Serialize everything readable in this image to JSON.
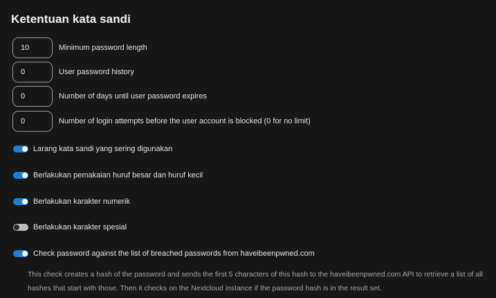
{
  "section": {
    "title": "Ketentuan kata sandi"
  },
  "number_settings": [
    {
      "value": "10",
      "label": "Minimum password length"
    },
    {
      "value": "0",
      "label": "User password history"
    },
    {
      "value": "0",
      "label": "Number of days until user password expires"
    },
    {
      "value": "0",
      "label": "Number of login attempts before the user account is blocked (0 for no limit)"
    }
  ],
  "toggles": [
    {
      "label": "Larang kata sandi yang sering digunakan",
      "enabled": true
    },
    {
      "label": "Berlakukan pemakaian huruf besar dan huruf kecil",
      "enabled": true
    },
    {
      "label": "Berlakukan karakter numerik",
      "enabled": true
    },
    {
      "label": "Berlakukan karakter spesial",
      "enabled": false
    },
    {
      "label": "Check password against the list of breached passwords from haveibeenpwned.com",
      "enabled": true
    }
  ],
  "breach_hint": "This check creates a hash of the password and sends the first 5 characters of this hash to the haveibeenpwned.com API to retrieve a list of all hashes that start with those. Then it checks on the Nextcloud instance if the password hash is in the result set.",
  "colors": {
    "background": "#171717",
    "toggle_on": "#1f7fd1",
    "toggle_off": "#bdbdbd",
    "input_border": "#9a9a9a"
  }
}
